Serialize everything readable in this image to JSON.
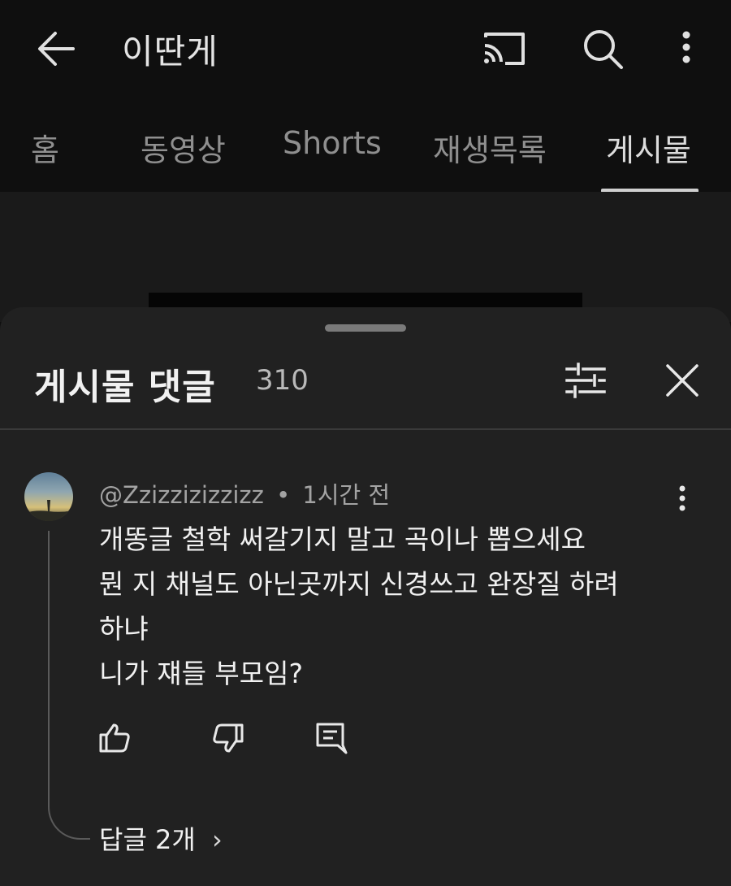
{
  "header": {
    "title": "이딴게",
    "back_icon": "arrow-left-icon",
    "cast_icon": "cast-icon",
    "search_icon": "search-icon",
    "more_icon": "more-vertical-icon"
  },
  "tabs": [
    {
      "label": "홈",
      "active": false
    },
    {
      "label": "동영상",
      "active": false
    },
    {
      "label": "Shorts",
      "active": false
    },
    {
      "label": "재생목록",
      "active": false
    },
    {
      "label": "게시물",
      "active": true
    }
  ],
  "comments_sheet": {
    "title": "게시물 댓글",
    "count": "310",
    "filter_icon": "sliders-icon",
    "close_icon": "close-icon"
  },
  "comment": {
    "author": "@Zzizzizizzizz",
    "separator": "•",
    "time": "1시간 전",
    "lines": [
      "개똥글 철학 써갈기지 말고 곡이나 뽑으세요",
      "뭔 지 채널도 아닌곳까지 신경쓰고 완장질 하려",
      "하냐",
      "니가 쟤들 부모임?"
    ],
    "like_icon": "thumbs-up-icon",
    "dislike_icon": "thumbs-down-icon",
    "reply_icon": "comment-reply-icon",
    "replies_label": "답글 2개",
    "replies_chevron": "›"
  }
}
